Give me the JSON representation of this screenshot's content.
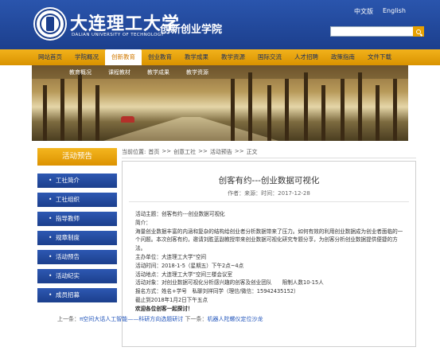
{
  "header": {
    "university_cn": "大连理工大学",
    "university_en": "DALIAN UNIVERSITY OF TECHNOLOGY",
    "college": "创新创业学院",
    "lang_cn": "中文版",
    "lang_en": "English",
    "search_placeholder": ""
  },
  "nav": {
    "items": [
      "网站首页",
      "学院概况",
      "创新教育",
      "创业教育",
      "教学成果",
      "教学资源",
      "国际交流",
      "人才招聘",
      "政策指南",
      "文件下载"
    ],
    "active_index": 2
  },
  "sub_nav": [
    "教育概况",
    "课程教材",
    "教学成果",
    "教学资源"
  ],
  "sidebar": {
    "title": "活动预告",
    "items": [
      "工社简介",
      "工社组织",
      "指导教师",
      "规章制度",
      "活动预告",
      "活动纪实",
      "成员招募"
    ]
  },
  "breadcrumb": {
    "prefix": "当前位置:",
    "items": [
      "首页",
      ">>",
      "创意工社",
      ">>",
      "活动预告",
      ">>",
      "正文"
    ]
  },
  "article": {
    "title": "创客有约---创业数据可视化",
    "meta": "作者：来源：时间：2017-12-28",
    "lines": [
      "活动主题：创客有约---创业数据可视化",
      "简介：",
      "海量创业数据丰富的内涵和复杂的结构给创业者分析数据带来了压力。如何有效的利用创业数据成为创业者面临的一个问题。本次创客有约，邀请刘胜蓝副教授带来创业数据可视化研究专题分享，为创客分析创业数据提供便捷的方法。",
      "主办单位：大连理工大学“空间",
      "活动时间：2018-1-5（星期五）下午2点~4点",
      "活动地点：大连理工大学“空间三楼会议室",
      "活动对象：对创业数据可视化分析感兴趣的创客及创业团队　　限制人数10-15人",
      "报名方式：姓名+学号　私聊刘祥同学（理信/微信：15942435152）",
      "截止到2018年1月2日下午五点",
      "欢迎各位创客一起探讨！"
    ],
    "bold_line_index": 9
  },
  "pager": {
    "prev_label": "上一条：",
    "prev_title": "π空间大话人工智能——科研方向选题研讨",
    "next_label": "下一条：",
    "next_title": "机器人陀螺仪定位沙龙"
  },
  "colors": {
    "header_blue": "#1c3f8d",
    "nav_gold": "#f2b21b",
    "link_blue": "#2255bb"
  }
}
